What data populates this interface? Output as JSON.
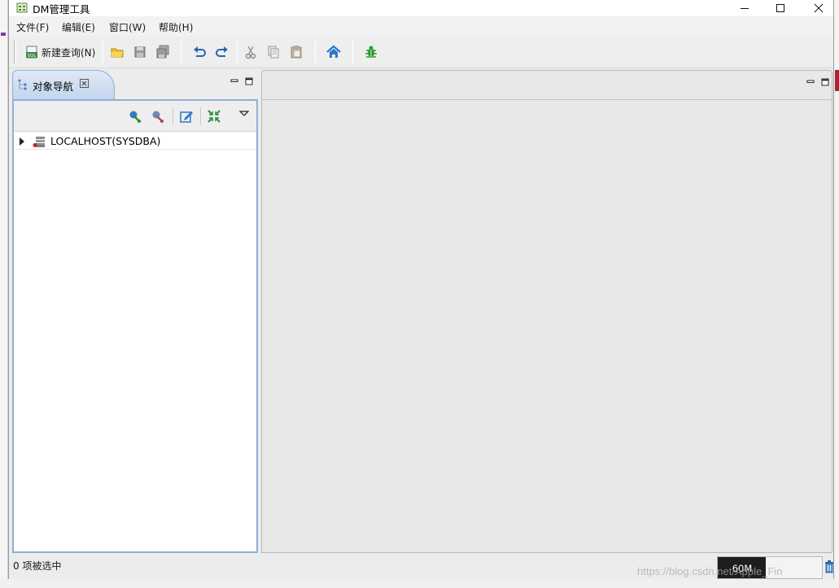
{
  "window": {
    "title": "DM管理工具"
  },
  "menu": {
    "items": [
      {
        "label": "文件(F)"
      },
      {
        "label": "编辑(E)"
      },
      {
        "label": "窗口(W)"
      },
      {
        "label": "帮助(H)"
      }
    ]
  },
  "toolbar": {
    "new_query_label": "新建查询(N)",
    "buttons": [
      {
        "icon": "sql-new-query-icon"
      },
      {
        "icon": "open-folder-icon"
      },
      {
        "icon": "save-icon"
      },
      {
        "icon": "save-all-icon"
      },
      {
        "icon": "undo-icon"
      },
      {
        "icon": "redo-icon"
      },
      {
        "icon": "cut-icon"
      },
      {
        "icon": "copy-icon"
      },
      {
        "icon": "paste-icon"
      },
      {
        "icon": "home-icon"
      },
      {
        "icon": "debug-bug-icon"
      }
    ]
  },
  "navigator": {
    "tab_label": "对象导航",
    "tools": [
      {
        "icon": "connect-icon"
      },
      {
        "icon": "disconnect-icon"
      },
      {
        "icon": "edit-icon"
      },
      {
        "icon": "collapse-all-icon"
      },
      {
        "icon": "view-menu-icon"
      }
    ],
    "tree": [
      {
        "label": "LOCALHOST(SYSDBA)",
        "icon": "database-server-icon",
        "expanded": false
      }
    ]
  },
  "status": {
    "selection_text": "0 项被选中",
    "heap_label": "60M",
    "heap_fraction": 0.46
  },
  "watermark": "https://blog.csdn.net/Apple_Fin",
  "colors": {
    "accent": "#8fb0d6",
    "tab_gradient_top": "#dfe9f5",
    "tab_gradient_bottom": "#c3d6ec",
    "home_blue": "#2b77c9",
    "bug_green": "#2e9b2e",
    "heap_fill": "#1e1e1e"
  }
}
